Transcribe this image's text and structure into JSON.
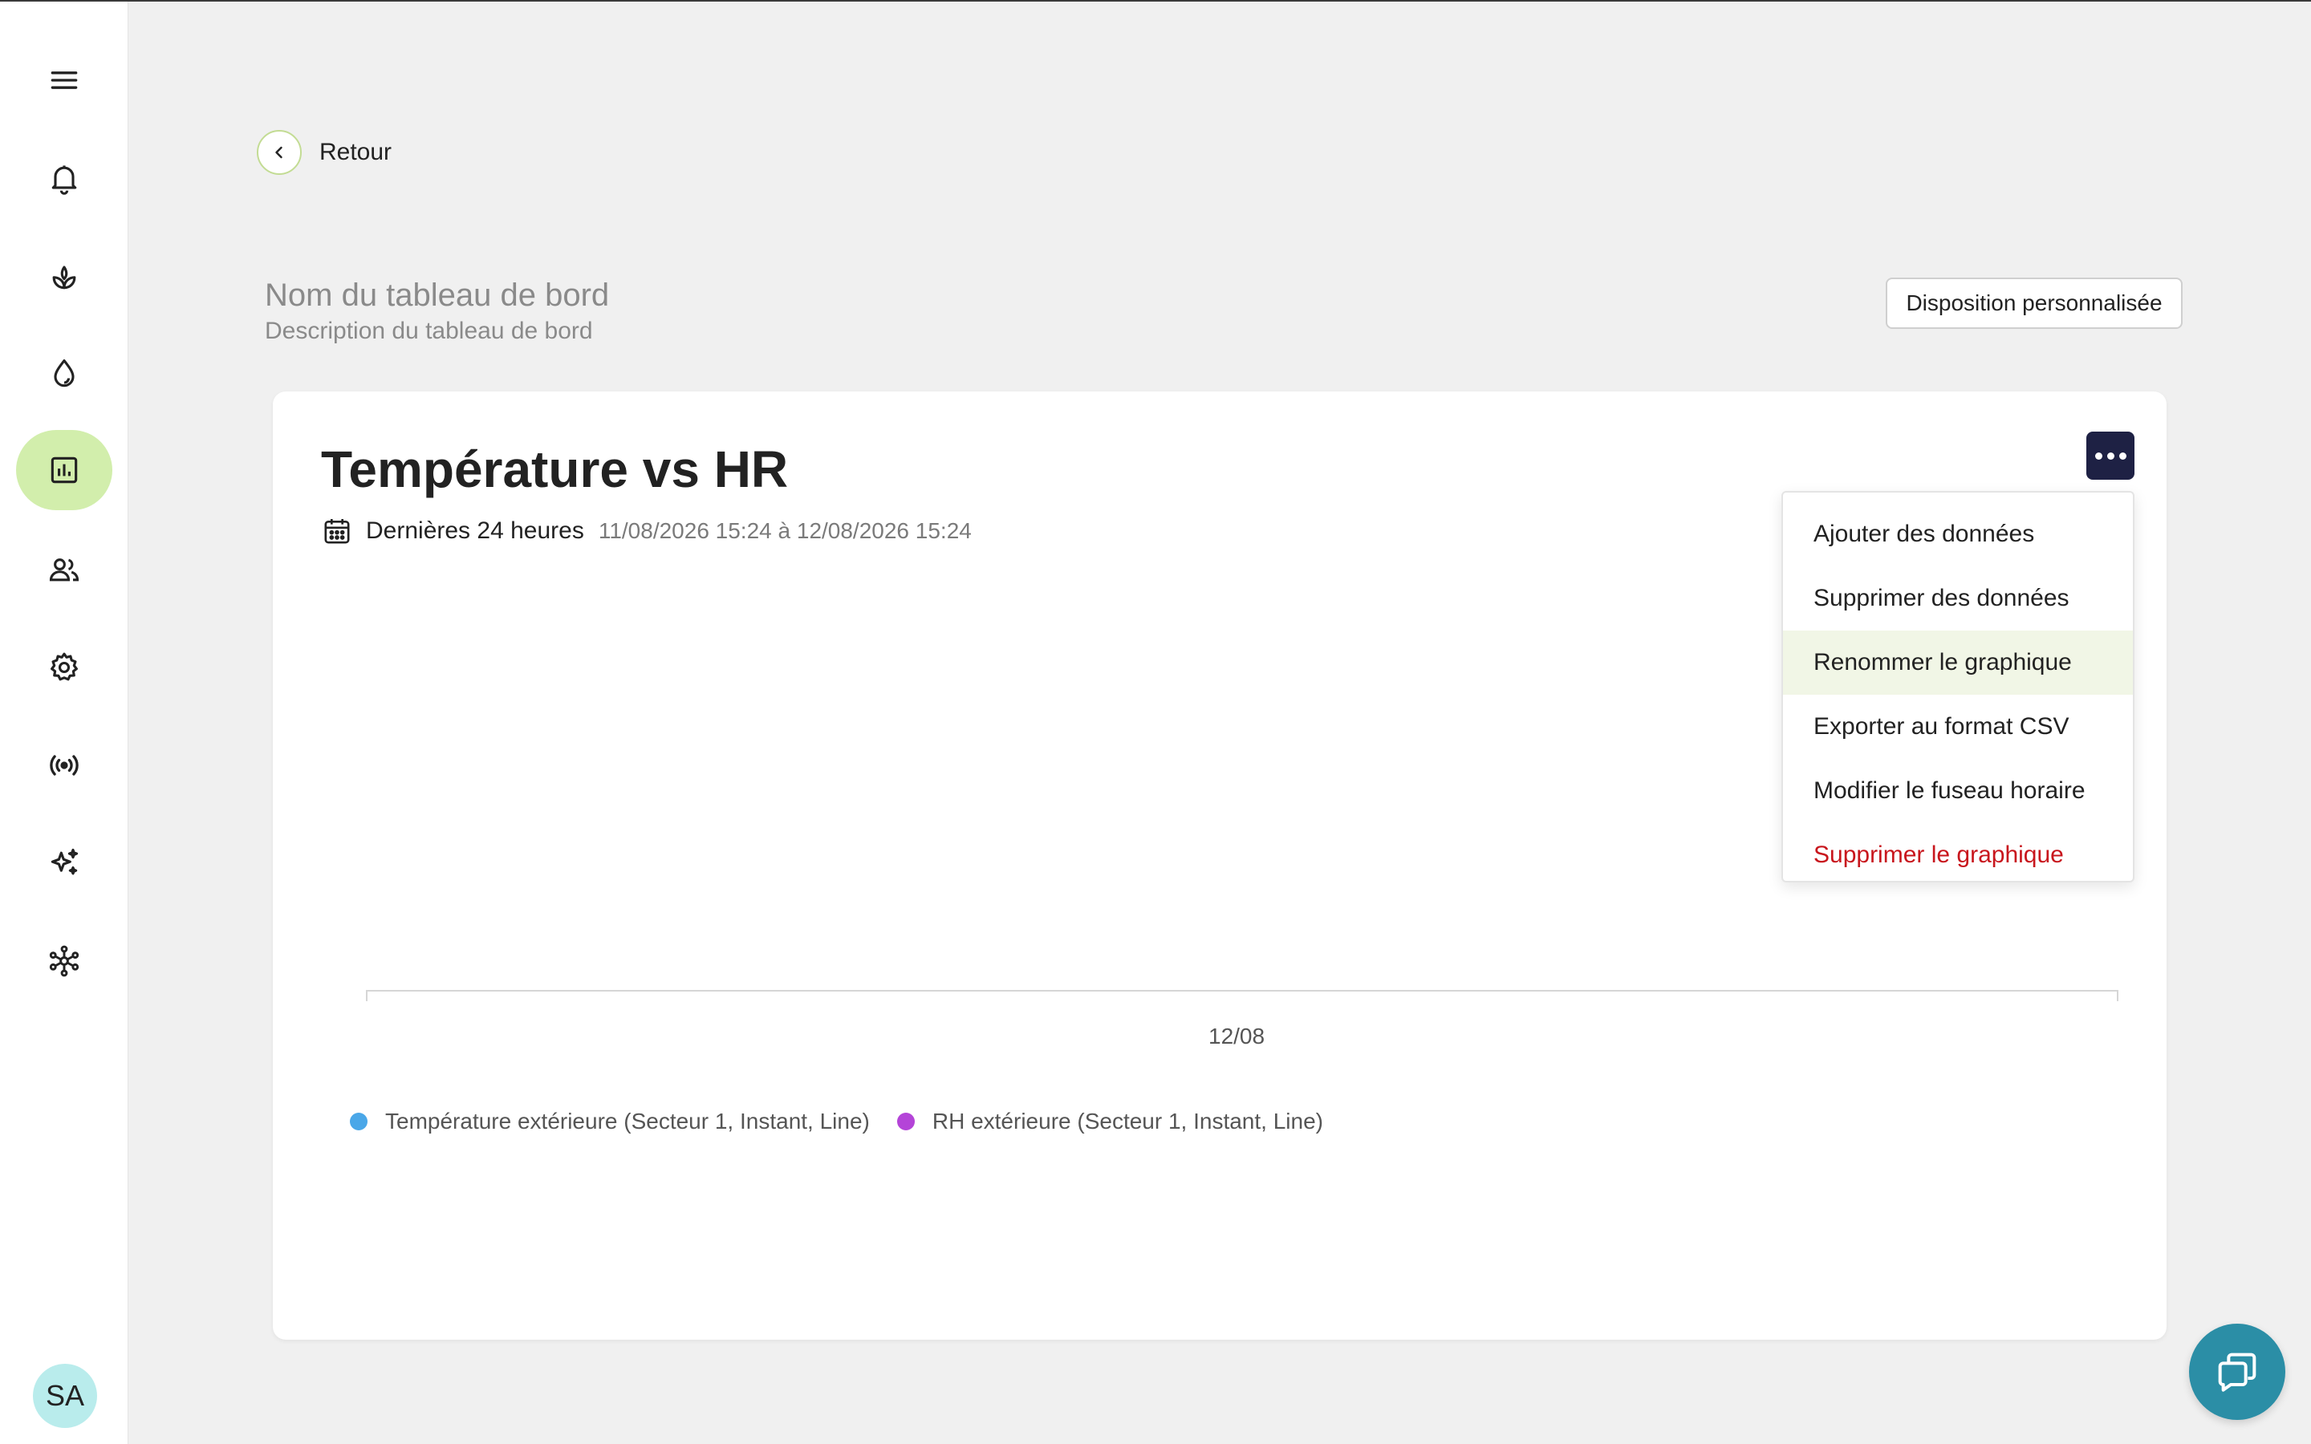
{
  "back": {
    "label": "Retour"
  },
  "dashboard": {
    "name_placeholder": "Nom du tableau de bord",
    "description_placeholder": "Description du tableau de bord",
    "layout_button": "Disposition personnalisée"
  },
  "sidebar": {
    "items": [
      {
        "icon": "menu-icon"
      },
      {
        "icon": "bell-icon"
      },
      {
        "icon": "sprout-icon"
      },
      {
        "icon": "water-drop-icon"
      },
      {
        "icon": "chart-icon",
        "active": true
      },
      {
        "icon": "users-icon"
      },
      {
        "icon": "gear-icon"
      },
      {
        "icon": "broadcast-icon"
      },
      {
        "icon": "sparkles-icon"
      },
      {
        "icon": "network-icon"
      }
    ],
    "avatar_initials": "SA",
    "active_color": "#d2eeac"
  },
  "chart_card": {
    "title": "Température vs HR",
    "period_label": "Dernières 24 heures",
    "period_range": "11/08/2026 15:24 à 12/08/2026 15:24"
  },
  "chart_data": {
    "type": "line",
    "x_ticks": [
      "12/08"
    ],
    "series": [
      {
        "name": "Température extérieure (Secteur 1, Instant, Line)",
        "color": "#4aa7e8",
        "values": []
      },
      {
        "name": "RH extérieure (Secteur 1, Instant, Line)",
        "color": "#b444d8",
        "values": []
      }
    ],
    "legend_position": "bottom-left",
    "grid": false
  },
  "menu": {
    "items": [
      {
        "label": "Ajouter des données"
      },
      {
        "label": "Supprimer des données"
      },
      {
        "label": "Renommer le graphique",
        "hovered": true
      },
      {
        "label": "Exporter au format CSV"
      },
      {
        "label": "Modifier le fuseau horaire"
      },
      {
        "label": "Supprimer le graphique",
        "danger": true
      }
    ]
  },
  "colors": {
    "more_button": "#1e2144",
    "chat_button": "#2b8ea6",
    "danger": "#c8161d"
  }
}
